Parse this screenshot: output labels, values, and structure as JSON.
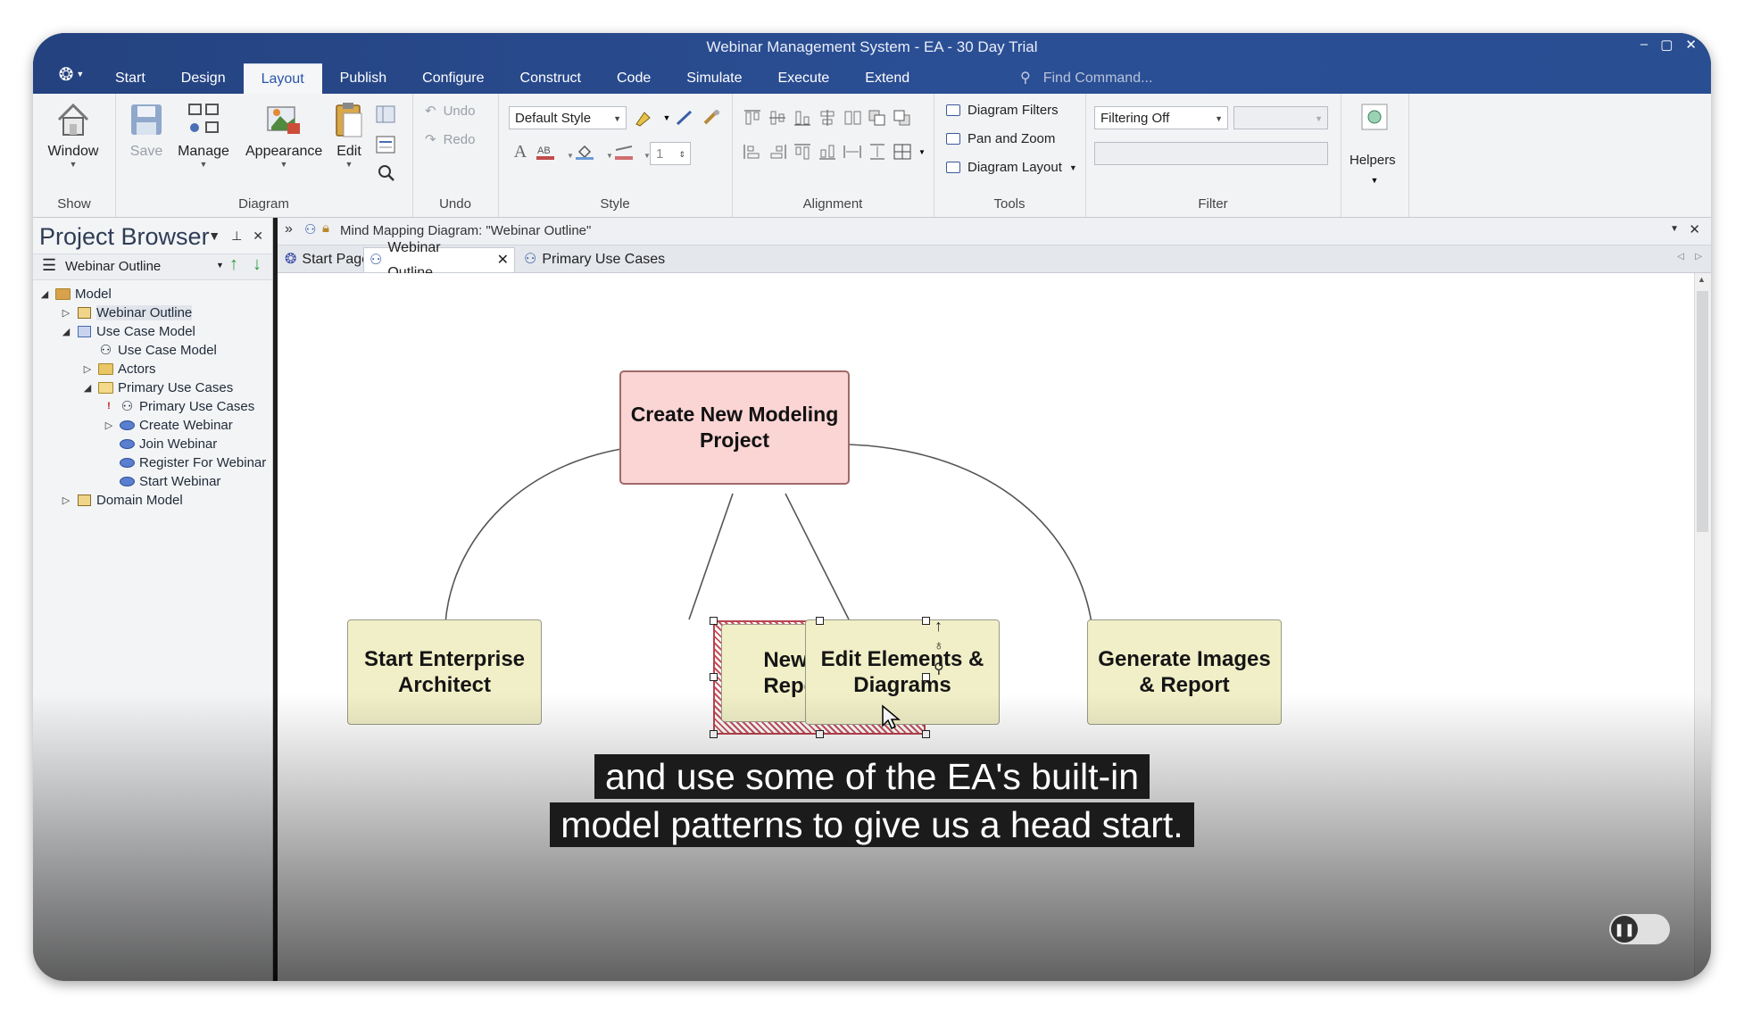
{
  "window": {
    "title": "Webinar Management System - EA - 30 Day Trial",
    "controls": [
      "–",
      "▢",
      "✕"
    ]
  },
  "ribbon_tabs": [
    "Start",
    "Design",
    "Layout",
    "Publish",
    "Configure",
    "Construct",
    "Code",
    "Simulate",
    "Execute",
    "Extend"
  ],
  "find_command": "Find Command...",
  "ribbon": {
    "show": {
      "label": "Show",
      "window": "Window"
    },
    "diagram": {
      "label": "Diagram",
      "save": "Save",
      "manage": "Manage",
      "appearance": "Appearance",
      "edit": "Edit"
    },
    "undo": {
      "label": "Undo",
      "undo": "Undo",
      "redo": "Redo"
    },
    "style": {
      "label": "Style",
      "combo": "Default Style",
      "width": "1"
    },
    "alignment": {
      "label": "Alignment"
    },
    "tools": {
      "label": "Tools",
      "filters": "Diagram Filters",
      "pan_zoom": "Pan and Zoom",
      "layout": "Diagram Layout"
    },
    "filter": {
      "label": "Filter",
      "combo": "Filtering Off"
    },
    "helpers": {
      "label": "Helpers"
    }
  },
  "project_browser": {
    "title": "Project Browser",
    "toolbar_selection": "Webinar Outline",
    "tree": [
      {
        "label": "Model"
      },
      {
        "label": "Webinar Outline"
      },
      {
        "label": "Use Case Model"
      },
      {
        "label": "Use Case Model"
      },
      {
        "label": "Actors"
      },
      {
        "label": "Primary Use Cases"
      },
      {
        "label": "Primary Use Cases",
        "marker": "!"
      },
      {
        "label": "Create Webinar"
      },
      {
        "label": "Join Webinar"
      },
      {
        "label": "Register For Webinar"
      },
      {
        "label": "Start Webinar"
      },
      {
        "label": "Domain Model"
      }
    ]
  },
  "diagram": {
    "header": "Mind Mapping Diagram: \"Webinar Outline\"",
    "tabs": [
      "Start Page",
      "Webinar Outline",
      "Primary Use Cases"
    ],
    "active_tab": "Webinar Outline",
    "root_node": "Create New Modeling Project",
    "child_nodes": [
      "Start Enterprise Architect",
      "New Model Repository",
      "Edit Elements & Diagrams",
      "Generate Images & Report"
    ],
    "selected_node": "New Model Repository"
  },
  "caption": {
    "line1": "and use some of the EA's built-in",
    "line2": "model patterns to give us a head start."
  },
  "colors": {
    "titlebar": "#2b4f95",
    "root_fill": "#fbd4d4",
    "child_fill": "#f1efc7",
    "selection": "#c4505b"
  }
}
